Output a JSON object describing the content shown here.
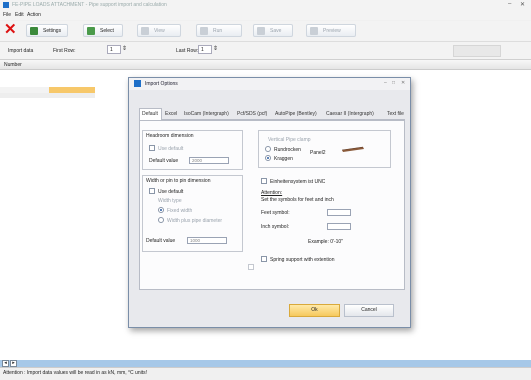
{
  "window": {
    "title": "FE-PIPE LOADS ATTACHMENT - Pipe support import and calculation",
    "min": "–",
    "close": "✕"
  },
  "menu": [
    "File",
    "Edit",
    "Action"
  ],
  "toolbar": {
    "settings": "Settings",
    "select": "Select",
    "view": "View",
    "run": "Run",
    "save": "Save",
    "preview": "Preview"
  },
  "rows": {
    "import_data": "Import data",
    "first_row": "First Row:",
    "first_row_value": "1",
    "last_row": "Last Row:",
    "last_row_value": "1"
  },
  "grid": {
    "header": "Number"
  },
  "status": "Attention : Import data values will be read in as kN, mm, °C units!",
  "dialog": {
    "title": "Import Options",
    "controls": {
      "min": "–",
      "max": "□",
      "close": "✕"
    },
    "tabs": [
      "Default",
      "Excel",
      "IsoCam (Intergraph)",
      "Pcf/SDS (pcf)",
      "AutoPipe (Bentley)",
      "Caesar II (Intergraph)",
      "Text file"
    ],
    "headroom": {
      "title": "Headroom dimension",
      "use_default": "Use default",
      "default_value_label": "Default value",
      "default_value": "2000"
    },
    "width": {
      "title": "Width or pin to pin dimension",
      "use_default": "Use default",
      "width_type": "Width type",
      "fixed_width": "Fixed width",
      "width_plus_pipe": "Width plus pipe diameter",
      "default_value_label": "Default value",
      "default_value": "1000"
    },
    "clamp": {
      "title": "Vertical Pipe clamp",
      "opt1": "Rundrocken",
      "opt2": "Kraggen",
      "image_label": "Panel2"
    },
    "units": {
      "imperial": "Einheitensystem ist UNC",
      "attention": "Attention:",
      "note": "Set the symbols for feet and inch",
      "feet": "Feet symbol:",
      "inch": "Inch symbol:",
      "example": "Example:  0'-10\""
    },
    "spring": "Spring support with extention",
    "ok": "Ok",
    "cancel": "Cancel"
  }
}
